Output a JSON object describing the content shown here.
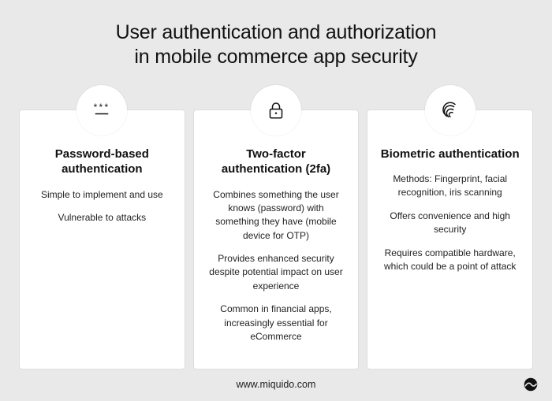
{
  "title_line1": "User authentication and authorization",
  "title_line2": "in mobile commerce app security",
  "cards": [
    {
      "icon": "password",
      "heading": "Password-based authentication",
      "points": [
        "Simple to implement and use",
        "Vulnerable to attacks"
      ]
    },
    {
      "icon": "lock",
      "heading": "Two-factor authentication (2fa)",
      "points": [
        "Combines something the user knows (password) with something they have (mobile device for OTP)",
        "Provides enhanced security despite potential impact on user experience",
        "Common in financial apps, increasingly essential for eCommerce"
      ]
    },
    {
      "icon": "fingerprint",
      "heading": "Biometric authentication",
      "points": [
        "Methods: Fingerprint, facial recognition, iris scanning",
        "Offers convenience and high security",
        "Requires compatible hardware, which could be a point of attack"
      ]
    }
  ],
  "footer": "www.miquido.com"
}
